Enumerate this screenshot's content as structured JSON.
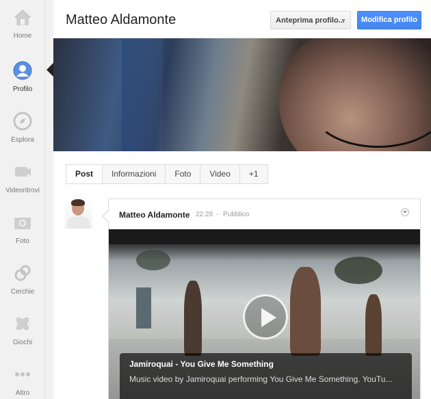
{
  "nav": {
    "items": [
      {
        "label": "Home",
        "icon": "home-icon"
      },
      {
        "label": "Profilo",
        "icon": "profile-icon"
      },
      {
        "label": "Esplora",
        "icon": "compass-icon"
      },
      {
        "label": "Videoritrovi",
        "icon": "video-camera-icon"
      },
      {
        "label": "Foto",
        "icon": "camera-icon"
      },
      {
        "label": "Cerchie",
        "icon": "circles-icon"
      },
      {
        "label": "Giochi",
        "icon": "games-icon"
      },
      {
        "label": "Altro",
        "icon": "more-dots-icon"
      }
    ],
    "active": "Profilo"
  },
  "header": {
    "name": "Matteo Aldamonte",
    "preview_label": "Anteprima profilo...",
    "edit_label": "Modifica profilo"
  },
  "tabs": [
    "Post",
    "Informazioni",
    "Foto",
    "Video",
    "+1"
  ],
  "post": {
    "author": "Matteo Aldamonte",
    "time": "22:28",
    "separator": "-",
    "audience": "Pubblico",
    "video": {
      "title": "Jamiroquai - You Give Me Something",
      "description": "Music video by Jamiroquai performing You Give Me Something. YouTu..."
    }
  },
  "colors": {
    "accent": "#4d90fe",
    "nav_bg": "#f1f1f1"
  }
}
